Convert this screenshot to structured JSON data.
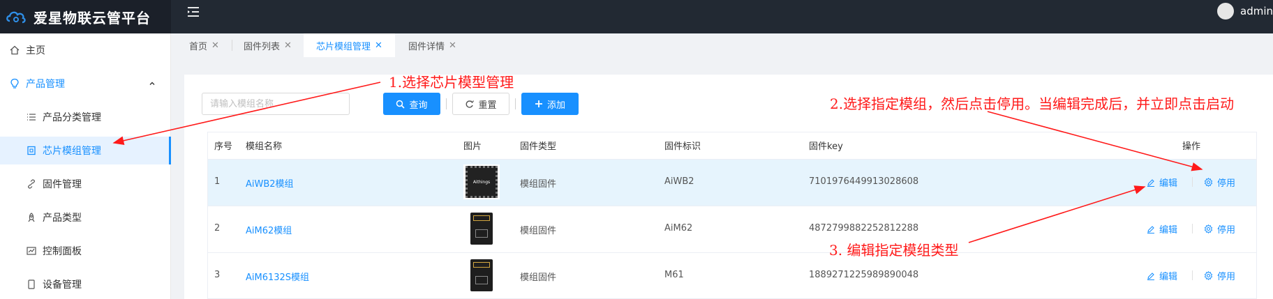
{
  "app": {
    "title": "爱星物联云管平台",
    "user": "admin"
  },
  "sidebar": {
    "items": [
      {
        "label": "主页",
        "icon": "home-icon"
      },
      {
        "label": "产品管理",
        "icon": "bulb-icon"
      },
      {
        "label": "产品分类管理",
        "icon": "list-icon"
      },
      {
        "label": "芯片模组管理",
        "icon": "chip-icon"
      },
      {
        "label": "固件管理",
        "icon": "link-icon"
      },
      {
        "label": "产品类型",
        "icon": "rocket-icon"
      },
      {
        "label": "控制面板",
        "icon": "chart-icon"
      },
      {
        "label": "设备管理",
        "icon": "device-icon"
      }
    ]
  },
  "tabs": [
    {
      "label": "首页"
    },
    {
      "label": "固件列表"
    },
    {
      "label": "芯片模组管理"
    },
    {
      "label": "固件详情"
    }
  ],
  "search": {
    "placeholder": "请输入模组名称",
    "query_label": "查询",
    "reset_label": "重置",
    "add_label": "添加"
  },
  "table": {
    "headers": [
      "序号",
      "模组名称",
      "图片",
      "固件类型",
      "固件标识",
      "固件key",
      "操作"
    ],
    "rows": [
      {
        "index": "1",
        "name": "AiWB2模组",
        "image_label": "Aithings",
        "firmware_type": "模组固件",
        "firmware_id": "AiWB2",
        "firmware_key": "7101976449913028608"
      },
      {
        "index": "2",
        "name": "AiM62模组",
        "image_label": "",
        "firmware_type": "模组固件",
        "firmware_id": "AiM62",
        "firmware_key": "4872799882252812288"
      },
      {
        "index": "3",
        "name": "AiM6132S模组",
        "image_label": "",
        "firmware_type": "模组固件",
        "firmware_id": "M61",
        "firmware_key": "1889271225989890048"
      }
    ],
    "edit_label": "编辑",
    "disable_label": "停用"
  },
  "annotations": {
    "note1": "1.选择芯片模型管理",
    "note2": "2.选择指定模组，然后点击停用。当编辑完成后，并立即点击启动",
    "note3": "3. 编辑指定模组类型"
  },
  "colors": {
    "accent": "#1890ff",
    "annotation": "#ff1a1a",
    "topbar": "#222933"
  }
}
